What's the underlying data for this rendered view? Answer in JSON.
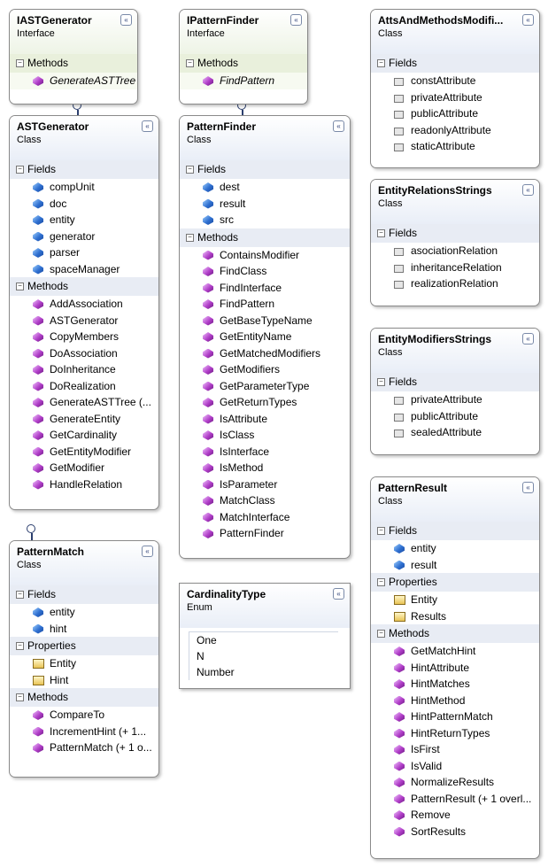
{
  "collapse_glyph": "«",
  "section_toggle": "−",
  "classes": {
    "iastgenerator": {
      "title": "IASTGenerator",
      "stereotype": "Interface",
      "methods_label": "Methods",
      "methods": [
        "GenerateASTTree"
      ]
    },
    "ipatternfinder": {
      "title": "IPatternFinder",
      "stereotype": "Interface",
      "methods_label": "Methods",
      "methods": [
        "FindPattern"
      ]
    },
    "attsandmethods": {
      "title": "AttsAndMethodsModifi...",
      "stereotype": "Class",
      "fields_label": "Fields",
      "fields": [
        "constAttribute",
        "privateAttribute",
        "publicAttribute",
        "readonlyAttribute",
        "staticAttribute"
      ]
    },
    "astgenerator": {
      "title": "ASTGenerator",
      "stereotype": "Class",
      "fields_label": "Fields",
      "fields": [
        "compUnit",
        "doc",
        "entity",
        "generator",
        "parser",
        "spaceManager"
      ],
      "methods_label": "Methods",
      "methods": [
        "AddAssociation",
        "ASTGenerator",
        "CopyMembers",
        "DoAssociation",
        "DoInheritance",
        "DoRealization",
        "GenerateASTTree (...",
        "GenerateEntity",
        "GetCardinality",
        "GetEntityModifier",
        "GetModifier",
        "HandleRelation"
      ]
    },
    "patternfinder": {
      "title": "PatternFinder",
      "stereotype": "Class",
      "fields_label": "Fields",
      "fields": [
        "dest",
        "result",
        "src"
      ],
      "methods_label": "Methods",
      "methods": [
        "ContainsModifier",
        "FindClass",
        "FindInterface",
        "FindPattern",
        "GetBaseTypeName",
        "GetEntityName",
        "GetMatchedModifiers",
        "GetModifiers",
        "GetParameterType",
        "GetReturnTypes",
        "IsAttribute",
        "IsClass",
        "IsInterface",
        "IsMethod",
        "IsParameter",
        "MatchClass",
        "MatchInterface",
        "PatternFinder"
      ]
    },
    "entityrelations": {
      "title": "EntityRelationsStrings",
      "stereotype": "Class",
      "fields_label": "Fields",
      "fields": [
        "asociationRelation",
        "inheritanceRelation",
        "realizationRelation"
      ]
    },
    "entitymodifiers": {
      "title": "EntityModifiersStrings",
      "stereotype": "Class",
      "fields_label": "Fields",
      "fields": [
        "privateAttribute",
        "publicAttribute",
        "sealedAttribute"
      ]
    },
    "patternmatch": {
      "title": "PatternMatch",
      "stereotype": "Class",
      "fields_label": "Fields",
      "fields": [
        "entity",
        "hint"
      ],
      "properties_label": "Properties",
      "properties": [
        "Entity",
        "Hint"
      ],
      "methods_label": "Methods",
      "methods": [
        "CompareTo",
        "IncrementHint (+ 1...",
        "PatternMatch (+ 1 o..."
      ]
    },
    "cardinalitytype": {
      "title": "CardinalityType",
      "stereotype": "Enum",
      "values": [
        "One",
        "N",
        "Number"
      ]
    },
    "patternresult": {
      "title": "PatternResult",
      "stereotype": "Class",
      "fields_label": "Fields",
      "fields": [
        "entity",
        "result"
      ],
      "properties_label": "Properties",
      "properties": [
        "Entity",
        "Results"
      ],
      "methods_label": "Methods",
      "methods": [
        "GetMatchHint",
        "HintAttribute",
        "HintMatches",
        "HintMethod",
        "HintPatternMatch",
        "HintReturnTypes",
        "IsFirst",
        "IsValid",
        "NormalizeResults",
        "PatternResult (+ 1 overl...",
        "Remove",
        "SortResults"
      ]
    }
  }
}
